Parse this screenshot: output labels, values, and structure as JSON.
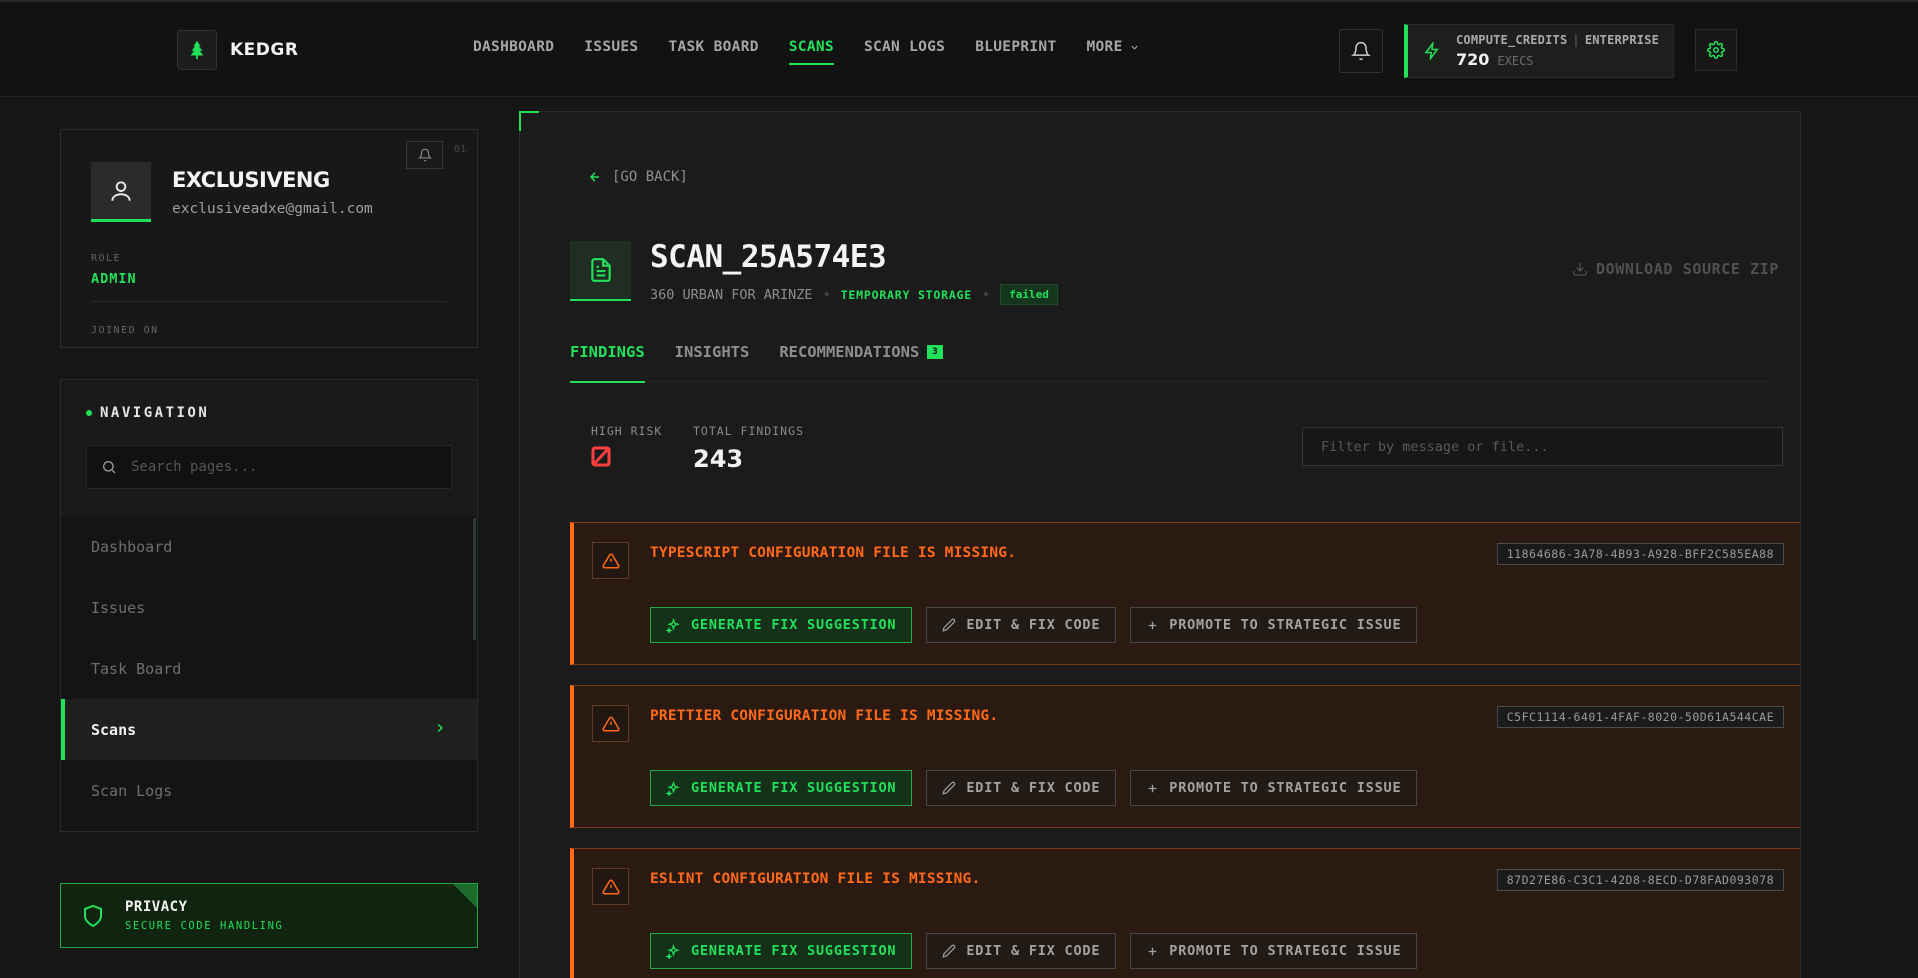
{
  "app": {
    "name": "KEDGR"
  },
  "topnav": {
    "items": [
      {
        "label": "DASHBOARD",
        "active": false
      },
      {
        "label": "ISSUES",
        "active": false
      },
      {
        "label": "TASK BOARD",
        "active": false
      },
      {
        "label": "SCANS",
        "active": true
      },
      {
        "label": "SCAN LOGS",
        "active": false
      },
      {
        "label": "BLUEPRINT",
        "active": false
      }
    ],
    "more_label": "MORE"
  },
  "credits": {
    "label": "COMPUTE_CREDITS",
    "plan": "ENTERPRISE",
    "value": "720",
    "unit": "EXECS"
  },
  "profile": {
    "username": "EXCLUSIVENG",
    "email": "exclusiveadxe@gmail.com",
    "role_label": "ROLE",
    "role": "ADMIN",
    "joined_label": "JOINED ON",
    "joined_value": "",
    "mini_id": "01"
  },
  "sidebar_nav": {
    "title": "NAVIGATION",
    "search_placeholder": "Search pages...",
    "items": [
      {
        "label": "Dashboard",
        "active": false
      },
      {
        "label": "Issues",
        "active": false
      },
      {
        "label": "Task Board",
        "active": false
      },
      {
        "label": "Scans",
        "active": true
      },
      {
        "label": "Scan Logs",
        "active": false
      }
    ]
  },
  "privacy": {
    "title": "PRIVACY",
    "subtitle": "SECURE CODE HANDLING"
  },
  "scan": {
    "back_label": "[GO BACK]",
    "title": "SCAN_25A574E3",
    "project": "360 URBAN FOR ARINZE",
    "storage": "TEMPORARY STORAGE",
    "status": "failed",
    "download_label": "DOWNLOAD SOURCE ZIP"
  },
  "tabs": [
    {
      "label": "FINDINGS",
      "active": true,
      "count": ""
    },
    {
      "label": "INSIGHTS",
      "active": false,
      "count": ""
    },
    {
      "label": "RECOMMENDATIONS",
      "active": false,
      "count": "3"
    }
  ],
  "stats": {
    "high_risk_label": "HIGH RISK",
    "high_risk_value": "0",
    "total_label": "TOTAL FINDINGS",
    "total_value": "243"
  },
  "filter": {
    "placeholder": "Filter by message or file..."
  },
  "actions": {
    "generate": "GENERATE FIX SUGGESTION",
    "edit": "EDIT & FIX CODE",
    "promote": "PROMOTE TO STRATEGIC ISSUE"
  },
  "findings": [
    {
      "message": "TYPESCRIPT CONFIGURATION FILE IS MISSING.",
      "id": "11864686-3A78-4B93-A928-BFF2C585EA88"
    },
    {
      "message": "PRETTIER CONFIGURATION FILE IS MISSING.",
      "id": "C5FC1114-6401-4FAF-8020-50D61A544CAE"
    },
    {
      "message": "ESLINT CONFIGURATION FILE IS MISSING.",
      "id": "87D27E86-C3C1-42D8-8ECD-D78FAD093078"
    }
  ],
  "colors": {
    "accent": "#22e05a",
    "warning": "#ff6a1a",
    "danger": "#ff4040",
    "background": "#161616"
  }
}
